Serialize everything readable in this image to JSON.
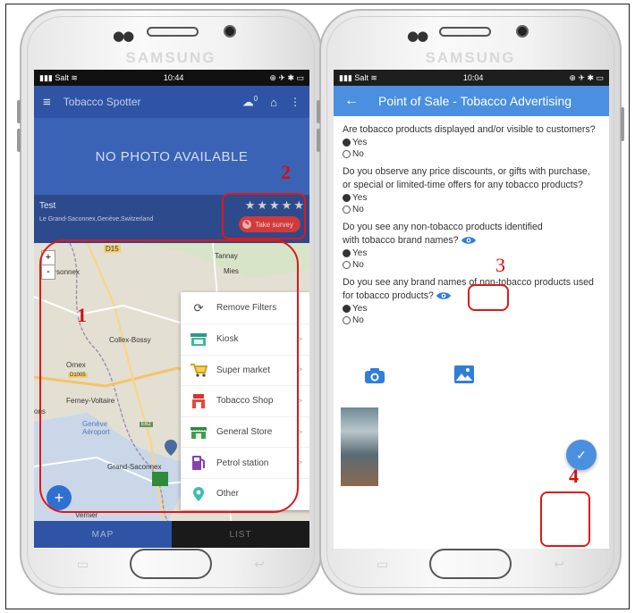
{
  "left_phone": {
    "brand": "SAMSUNG",
    "status": {
      "carrier": "Salt",
      "time": "10:44"
    },
    "appbar": {
      "title": "Tobacco Spotter",
      "badge": "0"
    },
    "no_photo": "NO PHOTO AVAILABLE",
    "place": {
      "name": "Test",
      "address": "Le Grand-Saconnex,Genève,Switzerland",
      "stars": "★★★★★",
      "survey_button": "Take survey"
    },
    "map": {
      "labels": [
        "D15",
        "Tannay",
        "Mies",
        "ersonnex",
        "Ornex",
        "Collex-Bossy",
        "D1005",
        "Ferney-Voltaire",
        "ons",
        "Genève Aéroport",
        "Grand-Saconnex",
        "Vernier",
        "E62"
      ],
      "filters": [
        {
          "label": "Remove Filters",
          "icon": "refresh-icon"
        },
        {
          "label": "Kiosk",
          "icon": "kiosk-icon"
        },
        {
          "label": "Super market",
          "icon": "cart-icon"
        },
        {
          "label": "Tobacco Shop",
          "icon": "tobacco-shop-icon"
        },
        {
          "label": "General Store",
          "icon": "store-icon"
        },
        {
          "label": "Petrol station",
          "icon": "fuel-icon"
        },
        {
          "label": "Other",
          "icon": "location-pin-icon"
        }
      ]
    },
    "tabs": {
      "map": "MAP",
      "list": "LIST"
    }
  },
  "right_phone": {
    "brand": "SAMSUNG",
    "status": {
      "carrier": "Salt",
      "time": "10:04"
    },
    "title": "Point of Sale - Tobacco Advertising",
    "questions": [
      {
        "text": "Are tobacco products displayed and/or visible to customers?",
        "yes": "Yes",
        "no": "No",
        "selected": "Yes"
      },
      {
        "text": "Do you observe any price discounts, or gifts with purchase, or special or limited-time offers for any tobacco products?",
        "yes": "Yes",
        "no": "No",
        "selected": "Yes"
      },
      {
        "text": "Do you see any non-tobacco products identified with tobacco brand names?",
        "yes": "Yes",
        "no": "No",
        "selected": "Yes"
      },
      {
        "text": "Do you see any brand names of non-tobacco products used for tobacco products?",
        "yes": "Yes",
        "no": "No",
        "selected": "Yes"
      }
    ]
  },
  "annotations": [
    "1",
    "2",
    "3",
    "4"
  ],
  "colors": {
    "annotation": "#e01818",
    "appbar": "#2f54a5",
    "survey_bar": "#4a8fe0"
  }
}
